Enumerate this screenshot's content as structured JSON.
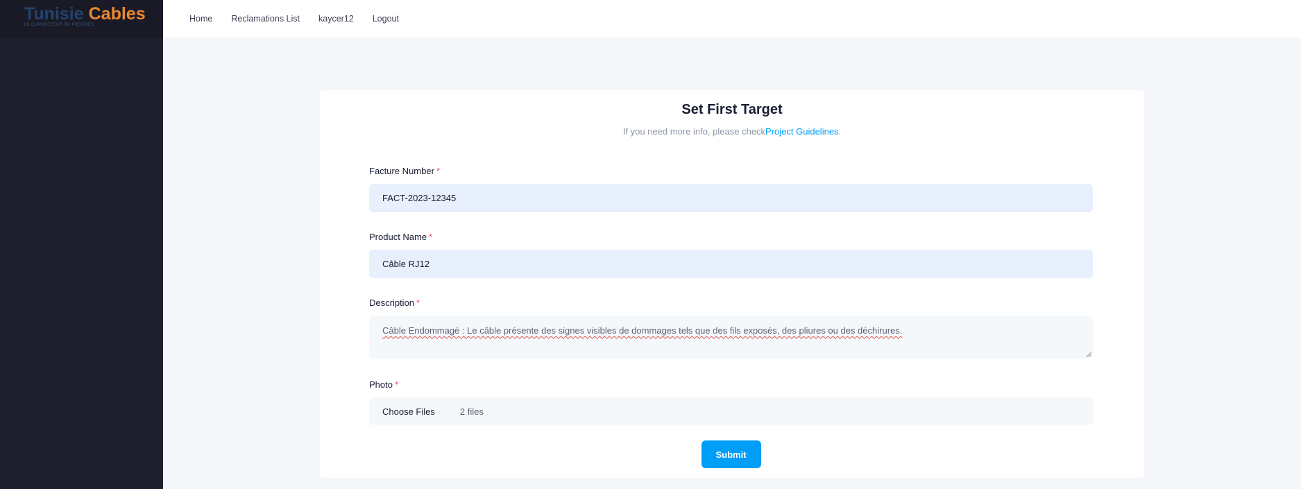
{
  "brand": {
    "word1": "Tunisie",
    "word2": "Cables",
    "tagline": "LE CONNECTEUR DU PROGRÈS"
  },
  "nav": {
    "home": "Home",
    "reclamations": "Reclamations List",
    "user": "kaycer12",
    "logout": "Logout"
  },
  "page": {
    "title": "Set First Target",
    "subtitle_prefix": "If you need more info, please check",
    "subtitle_link": "Project Guidelines",
    "subtitle_suffix": "."
  },
  "form": {
    "required_mark": "*",
    "facture_label": "Facture Number",
    "facture_value": "FACT-2023-12345",
    "product_label": "Product Name",
    "product_value": "Câble RJ12",
    "description_label": "Description",
    "description_value": "Câble Endommagé : Le câble présente des signes visibles de dommages tels que des fils exposés, des pliures ou des déchirures.",
    "photo_label": "Photo",
    "choose_files": "Choose Files",
    "files_count": "2 files",
    "submit": "Submit"
  },
  "colors": {
    "sidebar_bg": "#1e1e2d",
    "primary": "#009ef7",
    "required": "#f1416c",
    "brand_blue": "#23436b",
    "brand_orange": "#e8882e"
  }
}
